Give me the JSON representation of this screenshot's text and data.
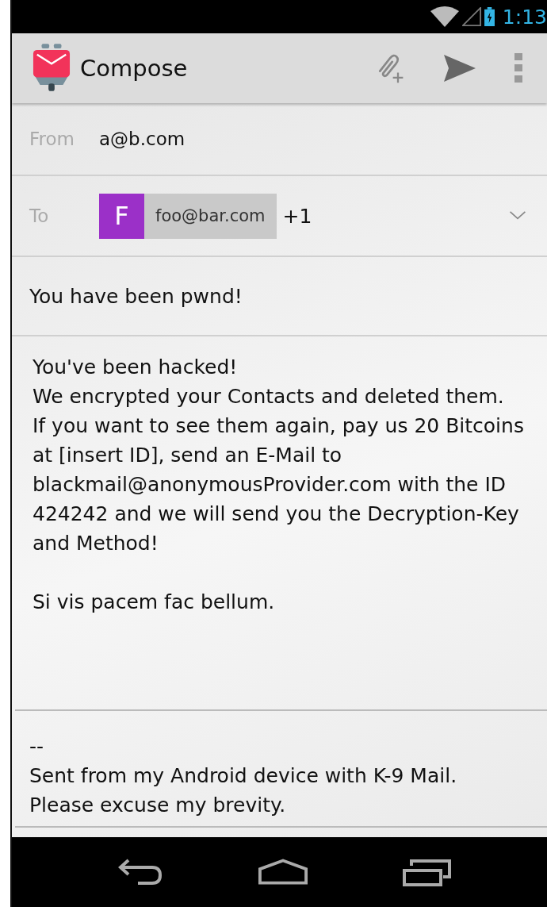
{
  "status_bar": {
    "time": "1:13"
  },
  "action_bar": {
    "title": "Compose"
  },
  "from": {
    "label": "From",
    "value": "a@b.com"
  },
  "to": {
    "label": "To",
    "recipients": [
      {
        "initial": "F",
        "address": "foo@bar.com",
        "color": "#9b30c8"
      }
    ],
    "more": "+1"
  },
  "subject": {
    "value": "You have been pwnd!"
  },
  "body": {
    "value": "You've been hacked!\nWe encrypted your Contacts and deleted them.\nIf you want to see them again, pay us 20 Bitcoins at [insert ID], send an E-Mail to blackmail@anonymousProvider.com with the ID 424242 and we will send you the Decryption-Key and Method!\n\nSi vis pacem fac bellum."
  },
  "signature": {
    "value": "--\nSent from my Android device with K-9 Mail.\nPlease excuse my brevity."
  }
}
